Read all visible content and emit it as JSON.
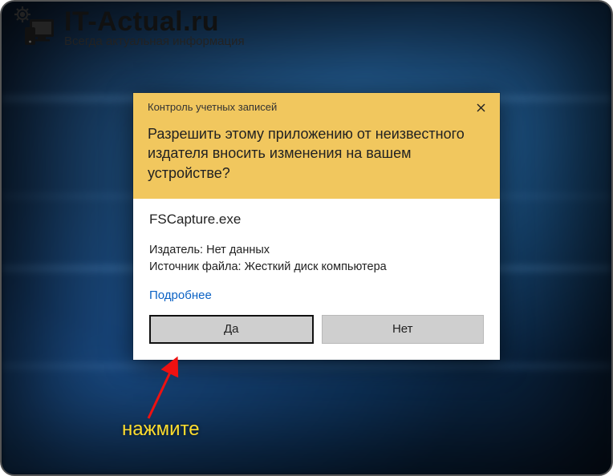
{
  "watermark": {
    "site_title": "IT-Actual.ru",
    "tagline": "Всегда актуальная информация"
  },
  "uac": {
    "titlebar": "Контроль учетных записей",
    "question": "Разрешить этому приложению от неизвестного издателя вносить изменения на вашем устройстве?",
    "program_name": "FSCapture.exe",
    "publisher_line": "Издатель: Нет данных",
    "source_line": "Источник файла: Жесткий диск компьютера",
    "more_link": "Подробнее",
    "btn_yes": "Да",
    "btn_no": "Нет"
  },
  "annotation": {
    "label": "нажмите"
  }
}
